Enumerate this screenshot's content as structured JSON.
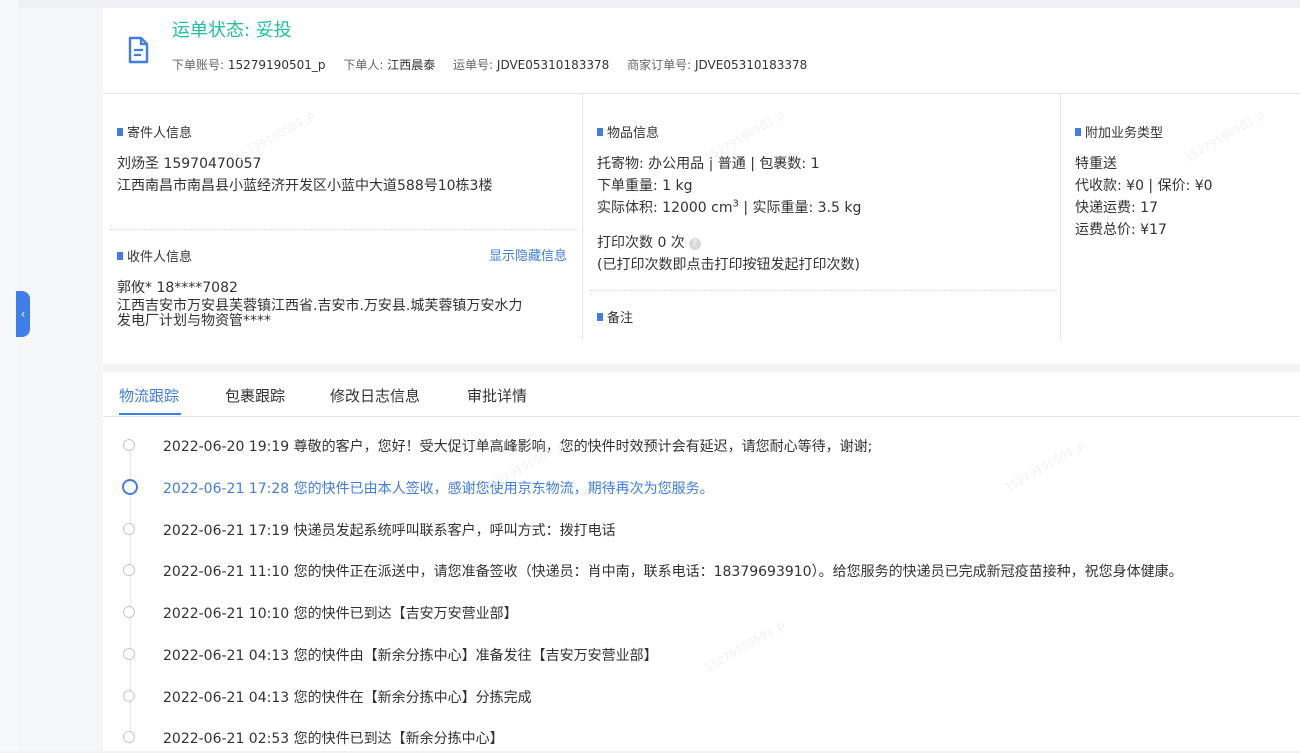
{
  "header": {
    "status_label": "运单状态: 妥投",
    "account_label": "下单账号:",
    "account_value": "15279190501_p",
    "orderer_label": "下单人:",
    "orderer_value": "江西晨泰",
    "waybill_label": "运单号:",
    "waybill_value": "JDVE05310183378",
    "merchant_order_label": "商家订单号:",
    "merchant_order_value": "JDVE05310183378"
  },
  "sender": {
    "title": "寄件人信息",
    "name_phone": "刘炀圣   15970470057",
    "address": "江西南昌市南昌县小蓝经济开发区小蓝中大道588号10栋3楼"
  },
  "receiver": {
    "title": "收件人信息",
    "show_hidden": "显示隐藏信息",
    "name_phone": "郭攸*   18****7082",
    "address_line1": "江西吉安市万安县芙蓉镇江西省.吉安市.万安县.城芙蓉镇万安水力",
    "address_line2": "发电厂计划与物资管****"
  },
  "goods": {
    "title": "物品信息",
    "line1": "托寄物:  办公用品 | 普通  | 包裹数:  1",
    "line2": "下单重量:  1 kg",
    "line3_prefix": "实际体积:   12000 cm",
    "line3_sup": "3",
    "line3_suffix": " | 实际重量:   3.5 kg",
    "print_count": "打印次数   0 次",
    "print_note": "(已打印次数即点击打印按钮发起打印次数)",
    "remark_title": "备注"
  },
  "extra": {
    "title": "附加业务类型",
    "line1": "特重送",
    "line2": "代收款:  ¥0  |  保价:  ¥0",
    "line3": "快递运费:   17",
    "line4": "运费总价:  ¥17"
  },
  "tabs": [
    "物流跟踪",
    "包裹跟踪",
    "修改日志信息",
    "审批详情"
  ],
  "timeline": [
    "2022-06-20 19:19 尊敬的客户，您好！受大促订单高峰影响，您的快件时效预计会有延迟，请您耐心等待，谢谢;",
    "2022-06-21 17:28 您的快件已由本人签收，感谢您使用京东物流，期待再次为您服务。",
    "2022-06-21 17:19 快递员发起系统呼叫联系客户，呼叫方式：拨打电话",
    "2022-06-21 11:10 您的快件正在派送中，请您准备签收（快递员：肖中南，联系电话：18379693910）。给您服务的快递员已完成新冠疫苗接种，祝您身体健康。",
    "2022-06-21 10:10 您的快件已到达【吉安万安营业部】",
    "2022-06-21 04:13 您的快件由【新余分拣中心】准备发往【吉安万安营业部】",
    "2022-06-21 04:13 您的快件在【新余分拣中心】分拣完成",
    "2022-06-21 02:53 您的快件已到达【新余分拣中心】"
  ],
  "watermark": "15279190501_p",
  "colors": {
    "accent": "#3f7ee8",
    "status": "#1ec0a4"
  }
}
